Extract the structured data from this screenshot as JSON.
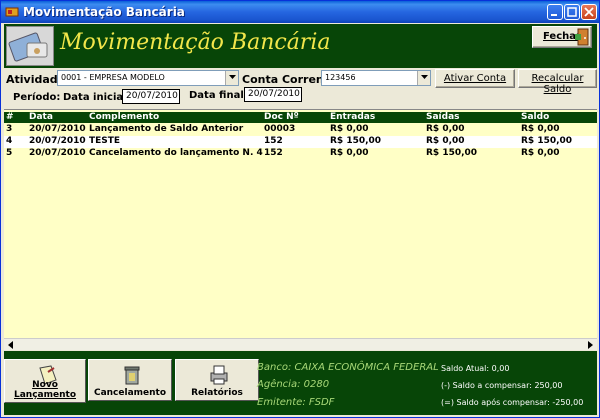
{
  "window": {
    "title": "Movimentação Bancária"
  },
  "header": {
    "title": "Movimentação Bancária",
    "close_label": "Fechar"
  },
  "filters": {
    "atividade_label": "Atividade:",
    "atividade_value": "0001 - EMPRESA MODELO",
    "conta_label": "Conta Corrente:",
    "conta_value": "123456",
    "ativar_label": "Ativar Conta",
    "recalcular_label": "Recalcular Saldo",
    "periodo_label": "Período:",
    "data_inicial_label": "Data inicial:",
    "data_inicial_value": "20/07/2010",
    "data_final_label": "Data final:",
    "data_final_value": "20/07/2010"
  },
  "grid": {
    "columns": [
      "#",
      "Data",
      "Complemento",
      "Doc Nº",
      "Entradas",
      "Saídas",
      "Saldo"
    ],
    "rows": [
      [
        "3",
        "20/07/2010",
        "Lançamento de Saldo Anterior",
        "00003",
        "R$ 0,00",
        "R$ 0,00",
        "R$ 0,00"
      ],
      [
        "4",
        "20/07/2010",
        "TESTE",
        "152",
        "R$ 150,00",
        "R$ 0,00",
        "R$ 150,00"
      ],
      [
        "5",
        "20/07/2010",
        "Cancelamento do lançamento N. 4",
        "152",
        "R$ 0,00",
        "R$ 150,00",
        "R$ 0,00"
      ]
    ]
  },
  "footer": {
    "novo_label": "Novo Lançamento",
    "cancelamento_label": "Cancelamento",
    "relatorios_label": "Relatórios",
    "banco": "Banco: CAIXA ECONÔMICA FEDERAL",
    "agencia": "Agência: 0280",
    "emitente": "Emitente: FSDF",
    "saldo_atual": "Saldo Atual: 0,00",
    "saldo_compensar": "(-) Saldo a compensar: 250,00",
    "saldo_apos": "(=) Saldo após compensar: -250,00"
  },
  "colors": {
    "header_green": "#074507",
    "title_yellow": "#f2e64a",
    "grid_bg": "#ffffc6"
  }
}
